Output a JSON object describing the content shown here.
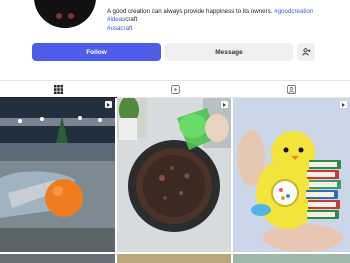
{
  "profile": {
    "bio_text": "A good creation can always provide happiness to its owners. ",
    "bio_tag1": "#goodcreation",
    "bio_tag2": "#ideas",
    "bio_line2_rest": "craft",
    "bio_tag3": "#usacraft"
  },
  "actions": {
    "follow_label": "Follow",
    "message_label": "Message",
    "add_user_icon": "add-user-icon"
  },
  "tabs": [
    {
      "icon": "grid-icon",
      "active": true
    },
    {
      "icon": "reels-icon",
      "active": false
    },
    {
      "icon": "tagged-icon",
      "active": false
    }
  ],
  "posts": [
    {
      "description_icon": "video-icon"
    },
    {
      "description_icon": "video-icon"
    },
    {
      "description_icon": "video-icon"
    }
  ],
  "colors": {
    "accent": "#4d5de8",
    "hashtag": "#3b5bdb"
  }
}
